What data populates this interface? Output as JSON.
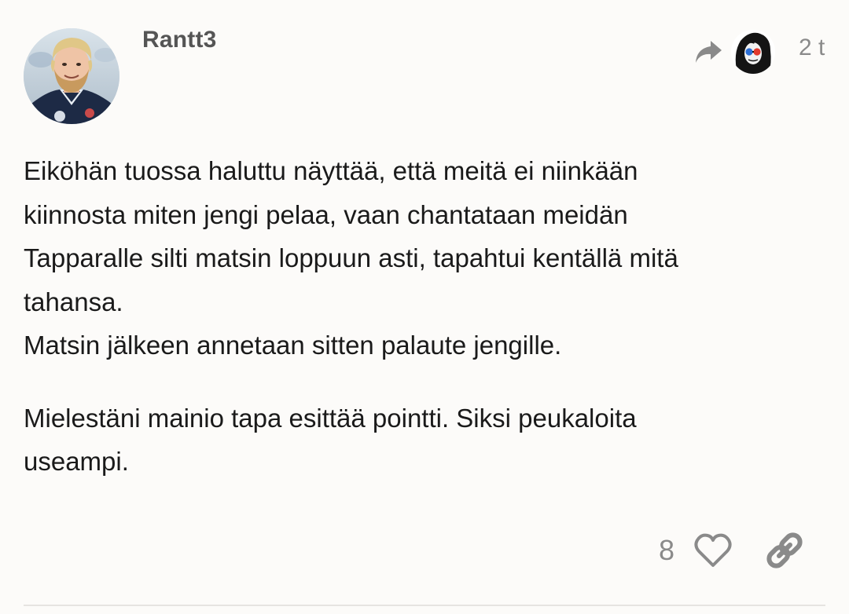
{
  "post": {
    "username": "Rantt3",
    "date": "2 t",
    "avatar_icon": "user-avatar-photo",
    "reply_to_icon": "reply-to-user-avatar",
    "body": {
      "paragraphs": [
        {
          "lines": [
            "Eiköhän tuossa haluttu näyttää, että meitä ei niinkään",
            "kiinnosta miten jengi pelaa, vaan chantataan meidän",
            "Tapparalle silti matsin loppuun asti, tapahtui kentällä mitä",
            "tahansa.",
            "Matsin jälkeen annetaan sitten palaute jengille."
          ]
        },
        {
          "lines": [
            "Mielestäni mainio tapa esittää pointti. Siksi peukaloita",
            "useampi."
          ]
        }
      ]
    },
    "actions": {
      "like_count": "8",
      "like_icon": "heart-icon",
      "share_icon": "link-icon",
      "reply_icon": "share-arrow-icon"
    }
  },
  "colors": {
    "background": "#fcfbf9",
    "text": "#1a1a1a",
    "muted": "#8a8a8a",
    "username": "#555555",
    "divider": "#e6e4e1"
  }
}
